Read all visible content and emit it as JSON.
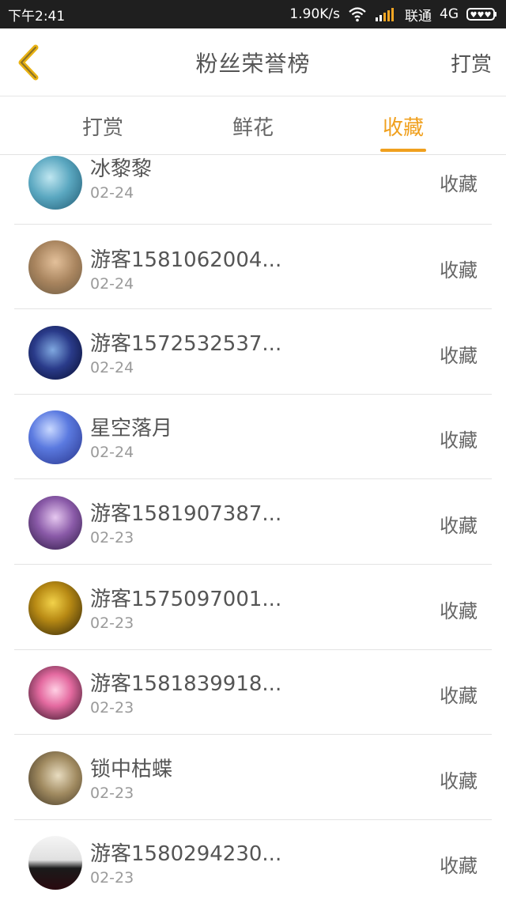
{
  "status_bar": {
    "time": "下午2:41",
    "speed": "1.90K/s",
    "carrier": "联通",
    "network": "4G",
    "icons": [
      "wifi-icon",
      "signal-icon",
      "battery-icon"
    ]
  },
  "header": {
    "title": "粉丝荣誉榜",
    "action": "打赏",
    "back_icon": "chevron-left-icon"
  },
  "tabs": [
    {
      "label": "打赏",
      "active": false
    },
    {
      "label": "鲜花",
      "active": false
    },
    {
      "label": "收藏",
      "active": true
    }
  ],
  "accent_color": "#f0a01e",
  "list": [
    {
      "name": "冰黎黎",
      "date": "02-24",
      "type": "收藏"
    },
    {
      "name": "游客1581062004...",
      "date": "02-24",
      "type": "收藏"
    },
    {
      "name": "游客1572532537...",
      "date": "02-24",
      "type": "收藏"
    },
    {
      "name": "星空落月",
      "date": "02-24",
      "type": "收藏"
    },
    {
      "name": "游客1581907387...",
      "date": "02-23",
      "type": "收藏"
    },
    {
      "name": "游客1575097001...",
      "date": "02-23",
      "type": "收藏"
    },
    {
      "name": "游客1581839918...",
      "date": "02-23",
      "type": "收藏"
    },
    {
      "name": "锁中枯蝶",
      "date": "02-23",
      "type": "收藏"
    },
    {
      "name": "游客1580294230...",
      "date": "02-23",
      "type": "收藏"
    }
  ]
}
